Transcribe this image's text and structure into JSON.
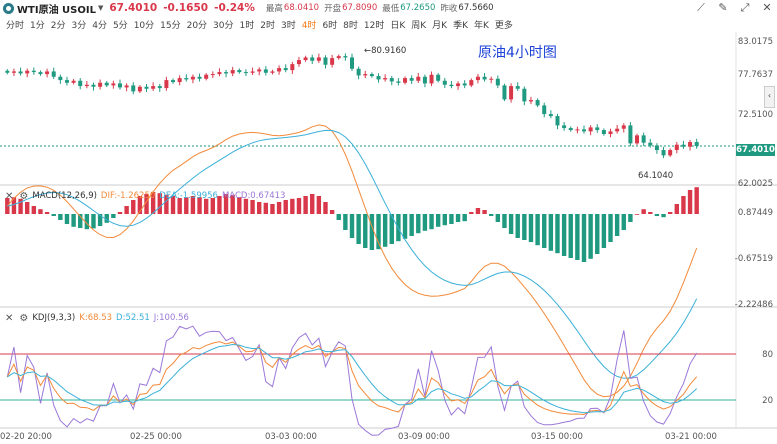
{
  "header": {
    "symbol": "WTI原油 USOIL",
    "last": "67.4010",
    "change": "-0.1650",
    "change_pct": "-0.24%",
    "high_label": "最高",
    "high": "68.0410",
    "open_label": "开盘",
    "open": "67.8090",
    "low_label": "最低",
    "low": "67.2650",
    "prev_label": "昨收",
    "prev": "67.5660"
  },
  "timeframes": [
    "分时",
    "1分",
    "2分",
    "3分",
    "4分",
    "5分",
    "10分",
    "15分",
    "20分",
    "30分",
    "1时",
    "2时",
    "3时",
    "4时",
    "6时",
    "8时",
    "12时",
    "日K",
    "周K",
    "月K",
    "季K",
    "年K",
    "更多"
  ],
  "active_timeframe": "4时",
  "chart_title": "原油4小时图",
  "annotations": {
    "high": "←80.9160",
    "low": "64.1040"
  },
  "price_axis": [
    "83.0175",
    "77.7637",
    "72.5100",
    "67.4010",
    "62.0025"
  ],
  "current_tag": "67.4010",
  "macd": {
    "name": "MACD(12,26,9)",
    "dif": "DIF:-1.26250",
    "dea": "DEA:-1.59956",
    "macd": "MACD:0.67413",
    "axis": [
      "0.87449",
      "-0.67519",
      "-2.22486"
    ]
  },
  "kdj": {
    "name": "KDJ(9,3,3)",
    "k": "K:68.53",
    "d": "D:52.51",
    "j": "J:100.56",
    "axis": [
      "80",
      "20"
    ]
  },
  "x_axis": [
    "02-20 20:00",
    "02-25 00:00",
    "03-03 00:00",
    "03-09 00:00",
    "03-15 00:00",
    "03-21 00:00"
  ],
  "colors": {
    "up": "#d9384a",
    "down": "#1f9a80",
    "dif": "#f28a3a",
    "dea": "#3ab0d8",
    "j": "#9a78d8",
    "tf_active": "#f27a1a",
    "title": "#1d43d6"
  },
  "icons": [
    "line-tool-icon",
    "brush-icon",
    "fullscreen-icon",
    "close-icon",
    "settings-icon"
  ],
  "chart_data": {
    "type": "candlestick",
    "price_range": [
      62.0025,
      83.0175
    ],
    "closes": [
      78.4,
      78.6,
      78.3,
      78.7,
      78.5,
      78.2,
      78.6,
      77.8,
      77.3,
      76.9,
      77.2,
      76.4,
      76.6,
      76.3,
      76.9,
      76.5,
      76.8,
      76.2,
      76.5,
      75.6,
      76.3,
      76.0,
      76.4,
      76.1,
      77.3,
      77.0,
      77.6,
      77.4,
      77.8,
      77.5,
      78.1,
      78.2,
      78.5,
      78.3,
      78.8,
      78.5,
      78.4,
      78.6,
      78.9,
      78.4,
      78.6,
      79.1,
      78.8,
      79.7,
      80.3,
      80.7,
      80.2,
      80.7,
      79.6,
      80.6,
      80.9,
      80.7,
      79.0,
      78.0,
      78.2,
      77.9,
      77.4,
      77.6,
      77.1,
      76.9,
      77.6,
      77.2,
      77.8,
      76.8,
      78.1,
      77.2,
      76.6,
      76.4,
      76.8,
      76.5,
      77.3,
      77.8,
      77.4,
      77.5,
      76.5,
      74.4,
      76.4,
      76.0,
      74.1,
      74.3,
      73.5,
      72.2,
      71.9,
      70.5,
      70.1,
      69.8,
      69.9,
      69.6,
      70.2,
      69.8,
      69.2,
      69.6,
      70.0,
      70.5,
      67.8,
      69.0,
      67.9,
      67.5,
      66.8,
      66.0,
      66.8,
      67.6,
      67.3,
      68.0,
      67.4
    ],
    "macd_hist": [
      0.4,
      0.42,
      0.38,
      0.3,
      0.2,
      0.12,
      0.05,
      -0.05,
      -0.15,
      -0.25,
      -0.32,
      -0.35,
      -0.38,
      -0.36,
      -0.3,
      -0.22,
      -0.1,
      0.05,
      0.2,
      0.35,
      0.45,
      0.5,
      0.55,
      0.52,
      0.48,
      0.45,
      0.4,
      0.42,
      0.45,
      0.42,
      0.38,
      0.4,
      0.45,
      0.5,
      0.48,
      0.42,
      0.38,
      0.35,
      0.3,
      0.28,
      0.25,
      0.3,
      0.35,
      0.38,
      0.4,
      0.45,
      0.5,
      0.45,
      0.3,
      0.1,
      -0.15,
      -0.4,
      -0.6,
      -0.75,
      -0.85,
      -0.9,
      -0.88,
      -0.82,
      -0.75,
      -0.68,
      -0.62,
      -0.55,
      -0.48,
      -0.42,
      -0.38,
      -0.32,
      -0.28,
      -0.25,
      -0.2,
      -0.18,
      0.05,
      0.15,
      0.1,
      -0.05,
      -0.2,
      -0.35,
      -0.5,
      -0.6,
      -0.65,
      -0.7,
      -0.78,
      -0.85,
      -0.92,
      -0.98,
      -1.05,
      -1.1,
      -1.15,
      -1.2,
      -1.12,
      -1.0,
      -0.85,
      -0.7,
      -0.55,
      -0.4,
      -0.2,
      0.0,
      0.12,
      0.05,
      -0.05,
      -0.08,
      0.05,
      0.25,
      0.45,
      0.6,
      0.67
    ]
  }
}
